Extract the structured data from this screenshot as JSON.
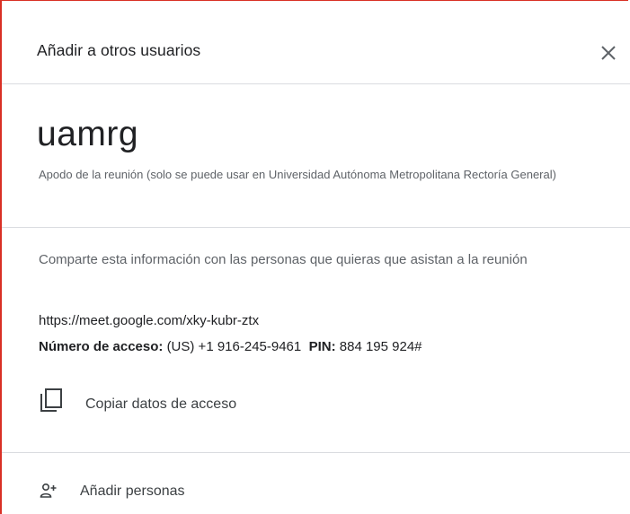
{
  "dialog": {
    "title": "Añadir a otros usuarios",
    "close_icon": "close-icon"
  },
  "meeting": {
    "nickname": "uamrg",
    "nickname_description": "Apodo de la reunión (solo se puede usar en Universidad Autónoma Metropolitana Rectoría General)"
  },
  "share": {
    "text": "Comparte esta información con las personas que quieras que asistan a la reunión",
    "link": "https://meet.google.com/xky-kubr-ztx",
    "access_label": "Número de acceso:",
    "access_number": "(US) +1 916-245-9461",
    "pin_label": "PIN:",
    "pin_value": "884 195 924#",
    "copy_label": "Copiar datos de acceso",
    "copy_icon": "copy-icon"
  },
  "actions": {
    "add_people_label": "Añadir personas",
    "add_people_icon": "add-person-icon"
  },
  "colors": {
    "border_accent": "#d93025",
    "divider": "#dadce0",
    "text_primary": "#202124",
    "text_secondary": "#5f6368"
  }
}
